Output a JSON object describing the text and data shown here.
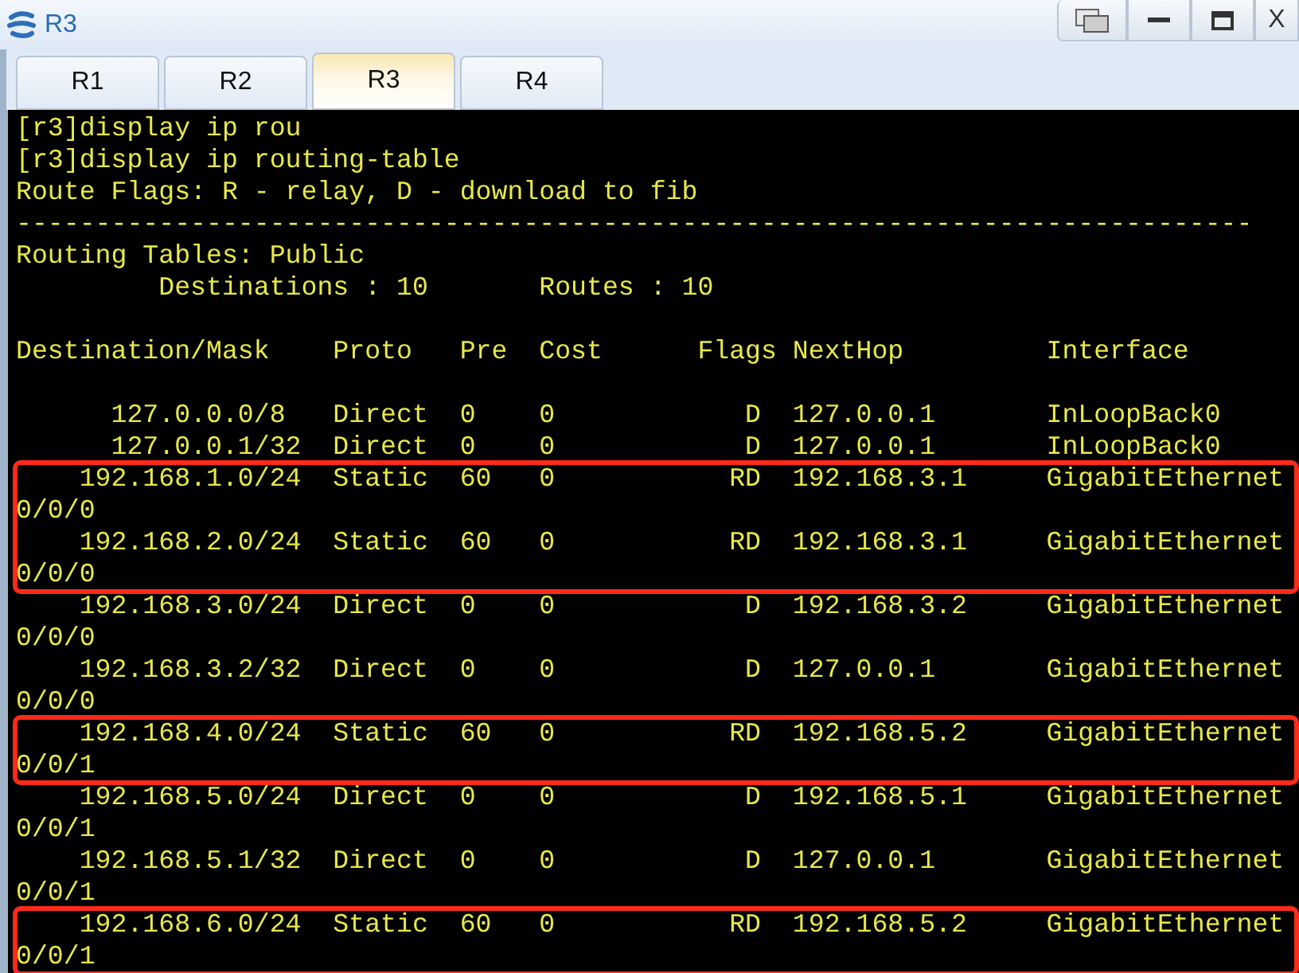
{
  "window": {
    "title": "R3",
    "close_label": "X"
  },
  "tabs": [
    {
      "label": "R1",
      "selected": false
    },
    {
      "label": "R2",
      "selected": false
    },
    {
      "label": "R3",
      "selected": true
    },
    {
      "label": "R4",
      "selected": false
    }
  ],
  "terminal": {
    "summary_lines": [
      "[r3]display ip rou",
      "[r3]display ip routing-table",
      "Route Flags: R - relay, D - download to fib",
      "------------------------------------------------------------------------------",
      "Routing Tables: Public",
      "         Destinations : 10       Routes : 10"
    ],
    "column_header": "Destination/Mask    Proto   Pre  Cost      Flags NextHop         Interface",
    "route_blocks": [
      {
        "highlighted": false,
        "lines": [
          "      127.0.0.0/8   Direct  0    0            D  127.0.0.1       InLoopBack0",
          "      127.0.0.1/32  Direct  0    0            D  127.0.0.1       InLoopBack0"
        ]
      },
      {
        "highlighted": true,
        "lines": [
          "    192.168.1.0/24  Static  60   0           RD  192.168.3.1     GigabitEthernet",
          "0/0/0",
          "    192.168.2.0/24  Static  60   0           RD  192.168.3.1     GigabitEthernet",
          "0/0/0"
        ]
      },
      {
        "highlighted": false,
        "lines": [
          "    192.168.3.0/24  Direct  0    0            D  192.168.3.2     GigabitEthernet",
          "0/0/0",
          "    192.168.3.2/32  Direct  0    0            D  127.0.0.1       GigabitEthernet",
          "0/0/0"
        ]
      },
      {
        "highlighted": true,
        "lines": [
          "    192.168.4.0/24  Static  60   0           RD  192.168.5.2     GigabitEthernet",
          "0/0/1"
        ]
      },
      {
        "highlighted": false,
        "lines": [
          "    192.168.5.0/24  Direct  0    0            D  192.168.5.1     GigabitEthernet",
          "0/0/1",
          "    192.168.5.1/32  Direct  0    0            D  127.0.0.1       GigabitEthernet",
          "0/0/1"
        ]
      },
      {
        "highlighted": true,
        "lines": [
          "    192.168.6.0/24  Static  60   0           RD  192.168.5.2     GigabitEthernet",
          "0/0/1"
        ]
      }
    ]
  }
}
